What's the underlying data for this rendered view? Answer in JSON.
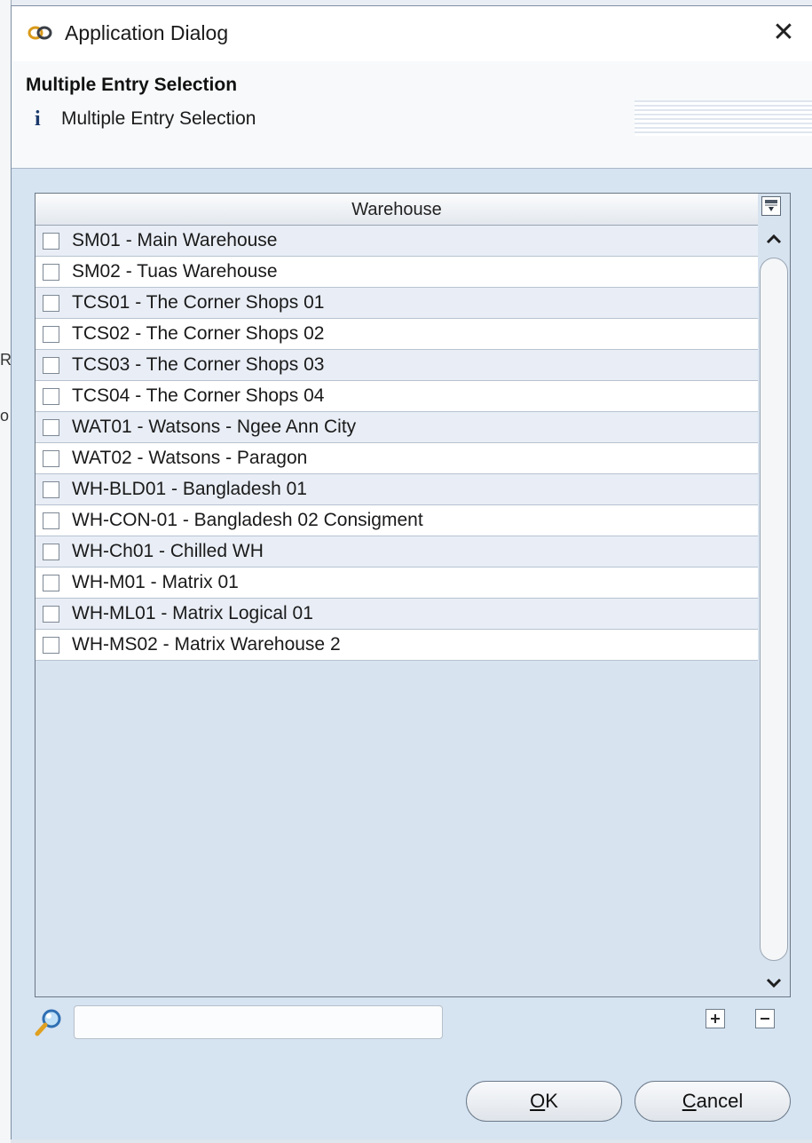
{
  "window": {
    "title": "Application Dialog",
    "close_symbol": "✕"
  },
  "header": {
    "title": "Multiple Entry Selection",
    "subtitle": "Multiple Entry Selection",
    "info_symbol": "i"
  },
  "grid": {
    "column_header": "Warehouse",
    "rows": [
      {
        "label": "SM01 - Main Warehouse",
        "checked": false
      },
      {
        "label": "SM02 - Tuas Warehouse",
        "checked": false
      },
      {
        "label": "TCS01 - The Corner Shops 01",
        "checked": false
      },
      {
        "label": "TCS02 - The Corner Shops 02",
        "checked": false
      },
      {
        "label": "TCS03 - The Corner Shops 03",
        "checked": false
      },
      {
        "label": "TCS04 - The Corner Shops 04",
        "checked": false
      },
      {
        "label": "WAT01 - Watsons - Ngee Ann City",
        "checked": false
      },
      {
        "label": "WAT02 - Watsons - Paragon",
        "checked": false
      },
      {
        "label": "WH-BLD01 - Bangladesh 01",
        "checked": false
      },
      {
        "label": "WH-CON-01 - Bangladesh 02 Consigment",
        "checked": false
      },
      {
        "label": "WH-Ch01 - Chilled WH",
        "checked": false
      },
      {
        "label": "WH-M01 - Matrix 01",
        "checked": false
      },
      {
        "label": "WH-ML01 - Matrix Logical 01",
        "checked": false
      },
      {
        "label": "WH-MS02 - Matrix Warehouse 2",
        "checked": false
      }
    ]
  },
  "search": {
    "value": "",
    "placeholder": ""
  },
  "buttons": {
    "ok_mnemonic": "O",
    "ok_rest": "K",
    "cancel_mnemonic": "C",
    "cancel_rest": "ancel"
  },
  "background": {
    "char_1": "R",
    "char_2": "o"
  },
  "icons": {
    "app": "link-icon",
    "info": "info-icon",
    "search": "magnifier-icon",
    "expand": "plus-box-icon",
    "collapse": "minus-box-icon",
    "column_menu": "column-chooser-icon"
  },
  "colors": {
    "dialog_bg": "#d6e3f1",
    "row_alt": "#e9eef6",
    "row": "#ffffff",
    "info_icon": "#1b3a6b"
  }
}
